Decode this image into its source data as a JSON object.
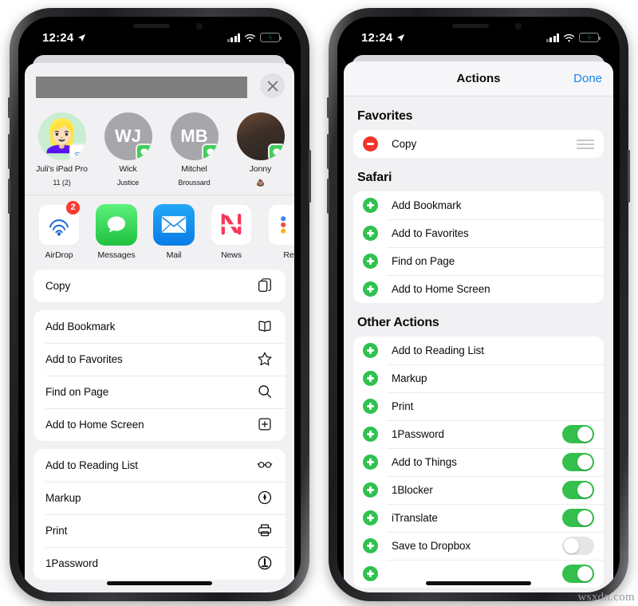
{
  "status_bar": {
    "time": "12:24",
    "location_icon": "location-arrow-icon",
    "signal_icon": "cellular-bars-icon",
    "wifi_icon": "wifi-icon",
    "battery_icon": "battery-charging-icon"
  },
  "colors": {
    "accent_blue": "#1484f5",
    "toggle_on_green": "#33c04d",
    "add_green": "#2fc24e",
    "remove_red": "#f2342b",
    "badge_red": "#fc3b30",
    "sheet_bg": "#f1f1f3",
    "card_bg": "#ffffff"
  },
  "left_phone": {
    "name": "share-sheet",
    "header": {
      "redacted_title": "",
      "close_label": "Close",
      "close_icon": "close-icon"
    },
    "contacts": [
      {
        "name": "Juli's iPad Pro",
        "name2": "11 (2)",
        "initials": "",
        "avatar_type": "memoji",
        "badge": "airdrop-icon"
      },
      {
        "name": "Wick",
        "name2": "Justice",
        "initials": "WJ",
        "avatar_type": "initials",
        "badge": "messages-icon"
      },
      {
        "name": "Mitchel",
        "name2": "Broussard",
        "initials": "MB",
        "avatar_type": "initials",
        "badge": "messages-icon"
      },
      {
        "name": "Jonny",
        "name2": "💩",
        "initials": "",
        "avatar_type": "photo",
        "badge": "messages-icon"
      }
    ],
    "apps": [
      {
        "label": "AirDrop",
        "icon": "airdrop-icon",
        "badge": "2"
      },
      {
        "label": "Messages",
        "icon": "messages-icon",
        "badge": ""
      },
      {
        "label": "Mail",
        "icon": "mail-icon",
        "badge": ""
      },
      {
        "label": "News",
        "icon": "news-icon",
        "badge": ""
      },
      {
        "label": "Re",
        "icon": "reminders-icon",
        "badge": ""
      }
    ],
    "groups": [
      {
        "name": "copy-group",
        "rows": [
          {
            "label": "Copy",
            "icon": "copy-icon"
          }
        ]
      },
      {
        "name": "safari-group",
        "rows": [
          {
            "label": "Add Bookmark",
            "icon": "book-icon"
          },
          {
            "label": "Add to Favorites",
            "icon": "star-icon"
          },
          {
            "label": "Find on Page",
            "icon": "search-icon"
          },
          {
            "label": "Add to Home Screen",
            "icon": "plus-square-icon"
          }
        ]
      },
      {
        "name": "other-actions-group",
        "rows": [
          {
            "label": "Add to Reading List",
            "icon": "glasses-icon"
          },
          {
            "label": "Markup",
            "icon": "markup-icon"
          },
          {
            "label": "Print",
            "icon": "printer-icon"
          },
          {
            "label": "1Password",
            "icon": "onepassword-icon"
          }
        ]
      }
    ]
  },
  "right_phone": {
    "name": "actions-editor",
    "navbar": {
      "title": "Actions",
      "done_label": "Done"
    },
    "sections": [
      {
        "title": "Favorites",
        "rows": [
          {
            "label": "Copy",
            "control": "remove",
            "trailing": "drag-handle",
            "toggle": null
          }
        ]
      },
      {
        "title": "Safari",
        "rows": [
          {
            "label": "Add Bookmark",
            "control": "add",
            "trailing": "none",
            "toggle": null
          },
          {
            "label": "Add to Favorites",
            "control": "add",
            "trailing": "none",
            "toggle": null
          },
          {
            "label": "Find on Page",
            "control": "add",
            "trailing": "none",
            "toggle": null
          },
          {
            "label": "Add to Home Screen",
            "control": "add",
            "trailing": "none",
            "toggle": null
          }
        ]
      },
      {
        "title": "Other Actions",
        "rows": [
          {
            "label": "Add to Reading List",
            "control": "add",
            "trailing": "none",
            "toggle": null
          },
          {
            "label": "Markup",
            "control": "add",
            "trailing": "none",
            "toggle": null
          },
          {
            "label": "Print",
            "control": "add",
            "trailing": "none",
            "toggle": null
          },
          {
            "label": "1Password",
            "control": "add",
            "trailing": "toggle",
            "toggle": "on"
          },
          {
            "label": "Add to Things",
            "control": "add",
            "trailing": "toggle",
            "toggle": "on"
          },
          {
            "label": "1Blocker",
            "control": "add",
            "trailing": "toggle",
            "toggle": "on"
          },
          {
            "label": "iTranslate",
            "control": "add",
            "trailing": "toggle",
            "toggle": "on"
          },
          {
            "label": "Save to Dropbox",
            "control": "add",
            "trailing": "toggle",
            "toggle": "off"
          }
        ]
      }
    ]
  },
  "watermark": "wsxdn.com"
}
